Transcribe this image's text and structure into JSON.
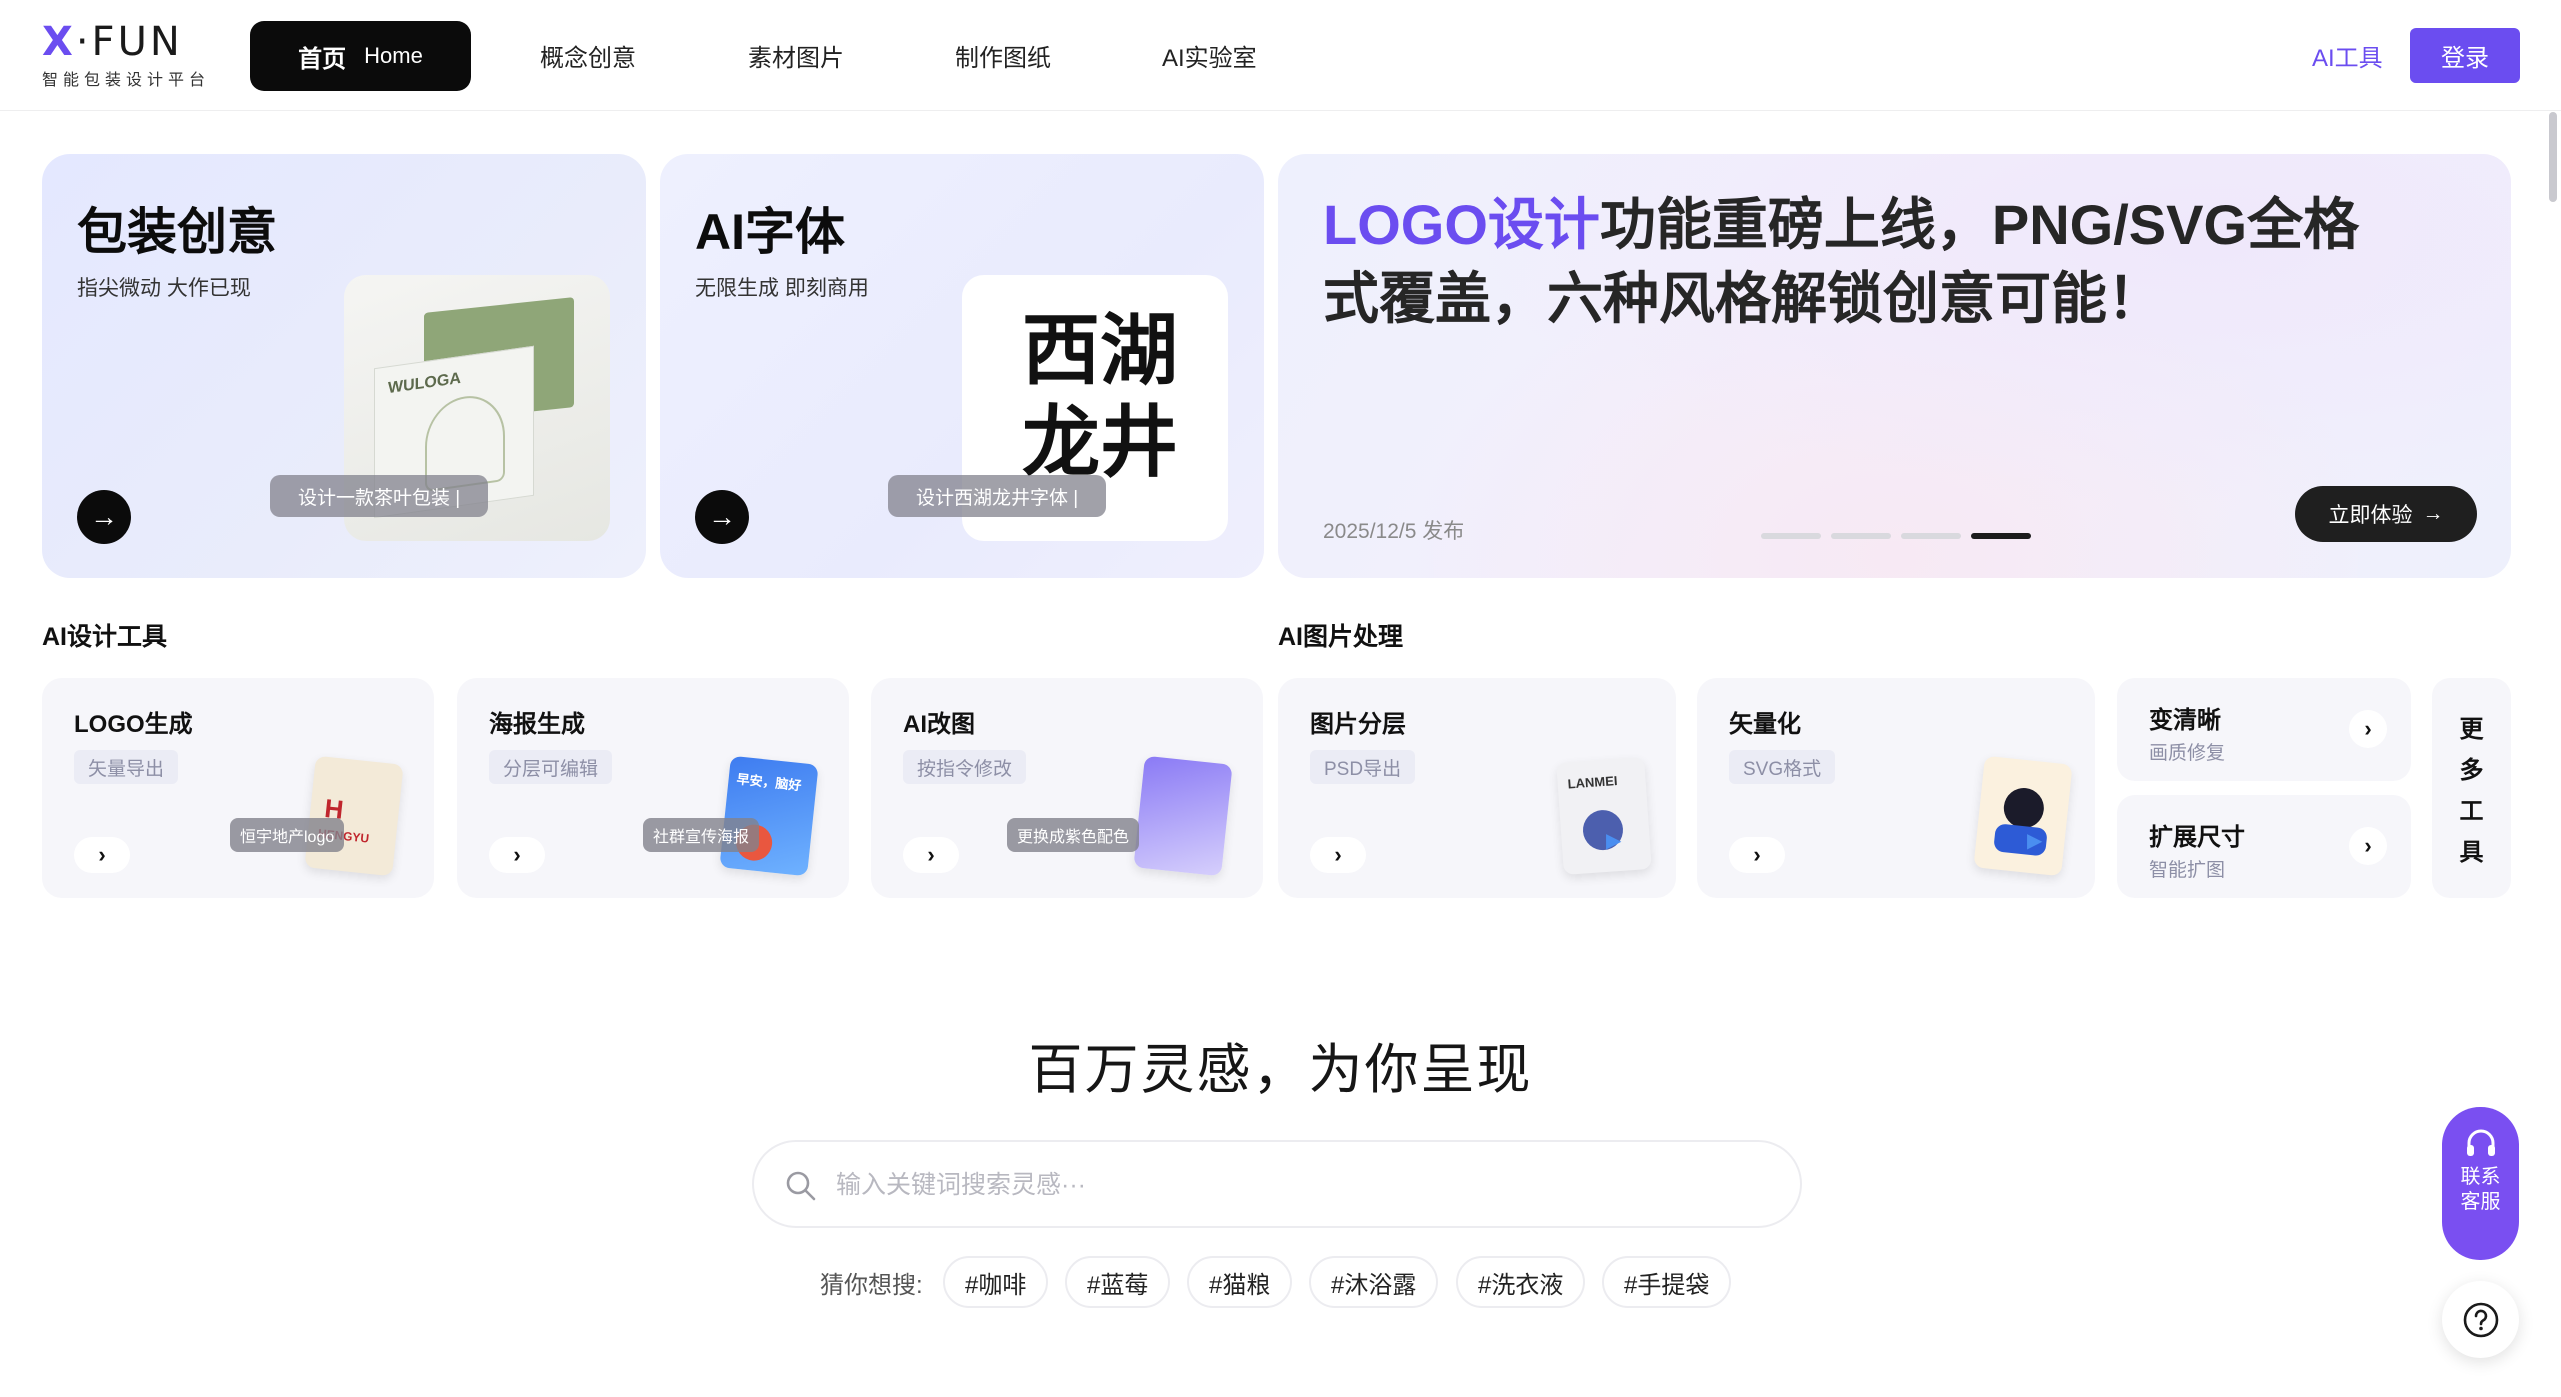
{
  "brand": {
    "name_x": "X",
    "name_rest": "·FUN",
    "tagline": "智能包装设计平台",
    "accent": "#6b4df0"
  },
  "nav": {
    "home_cn": "首页",
    "home_en": "Home",
    "items": [
      "概念创意",
      "素材图片",
      "制作图纸",
      "AI实验室"
    ],
    "ai_tools": "AI工具",
    "login": "登录"
  },
  "hero": {
    "packaging": {
      "title": "包装创意",
      "subtitle": "指尖微动 大作已现",
      "chip": "设计一款茶叶包装 |",
      "box_brand": "WULOGA"
    },
    "font": {
      "title": "AI字体",
      "subtitle": "无限生成 即刻商用",
      "chip": "设计西湖龙井字体 |",
      "calligraphy": "西湖龙井"
    },
    "banner": {
      "headline_accent": "LOGO设计",
      "headline_rest": "功能重磅上线，PNG/SVG全格式覆盖，六种风格解锁创意可能！",
      "date": "2025/12/5 发布",
      "cta": "立即体验",
      "slides": 4,
      "active_slide": 4
    }
  },
  "sections": {
    "design_tools": "AI设计工具",
    "image_tools": "AI图片处理"
  },
  "design_tools": [
    {
      "name": "LOGO生成",
      "tag": "矢量导出",
      "chip": "恒宇地产logo",
      "thumb_text": "HENGYU"
    },
    {
      "name": "海报生成",
      "tag": "分层可编辑",
      "chip": "社群宣传海报",
      "thumb_text": "早安，脑好"
    },
    {
      "name": "AI改图",
      "tag": "按指令修改",
      "chip": "更换成紫色配色",
      "thumb_text": ""
    }
  ],
  "image_tools": [
    {
      "name": "图片分层",
      "tag": "PSD导出",
      "thumb_text": "LANMEI"
    },
    {
      "name": "矢量化",
      "tag": "SVG格式",
      "thumb_text": ""
    }
  ],
  "mini_tools": [
    {
      "name": "变清晰",
      "sub": "画质修复"
    },
    {
      "name": "扩展尺寸",
      "sub": "智能扩图"
    }
  ],
  "more_tools": [
    "更",
    "多",
    "工",
    "具"
  ],
  "inspiration": {
    "title": "百万灵感，为你呈现",
    "search_placeholder": "输入关键词搜索灵感···",
    "guess_label": "猜你想搜:",
    "tags": [
      "#咖啡",
      "#蓝莓",
      "#猫粮",
      "#沐浴露",
      "#洗衣液",
      "#手提袋"
    ]
  },
  "floating": {
    "contact": "联系客服",
    "help_icon": "question-icon",
    "contact_icon": "headset-icon"
  }
}
